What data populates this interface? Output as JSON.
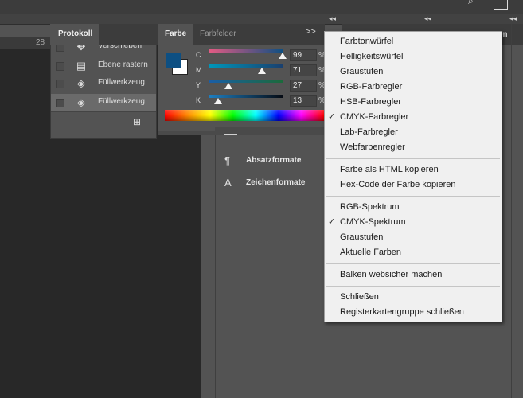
{
  "ruler": {
    "number": "28"
  },
  "dock": {
    "collapse_arrow": "◂◂"
  },
  "history_panel": {
    "tab_label": "Protokoll",
    "rows": [
      {
        "label": "Verschieben",
        "icon": "move-icon",
        "selected": false
      },
      {
        "label": "Ebene rastern",
        "icon": "document-icon",
        "selected": false
      },
      {
        "label": "Füllwerkzeug",
        "icon": "paint-bucket-icon",
        "selected": false
      },
      {
        "label": "Füllwerkzeug",
        "icon": "paint-bucket-icon",
        "selected": true
      }
    ],
    "new_snapshot_icon": "camera-icon"
  },
  "color_panel": {
    "tabs": [
      {
        "label": "Farbe"
      },
      {
        "label": "Farbfelder"
      }
    ],
    "foreground_color": "#0d4f82",
    "background_color": "#ffffff",
    "sliders": [
      {
        "label": "C",
        "value": "99",
        "unit": "%",
        "fraction": 0.99
      },
      {
        "label": "M",
        "value": "71",
        "unit": "%",
        "fraction": 0.71
      },
      {
        "label": "Y",
        "value": "27",
        "unit": "%",
        "fraction": 0.27
      },
      {
        "label": "K",
        "value": "13",
        "unit": "%",
        "fraction": 0.13
      }
    ],
    "expand_label": ">>"
  },
  "paragraph_panel": {
    "items": [
      {
        "label": "Absatzformate",
        "icon": "paragraph-styles-icon"
      },
      {
        "label": "Zeichenformate",
        "icon": "character-styles-icon"
      }
    ]
  },
  "context_menu": {
    "groups": [
      [
        {
          "label": "Farbtonwürfel",
          "checked": false
        },
        {
          "label": "Helligkeitswürfel",
          "checked": false
        },
        {
          "label": "Graustufen",
          "checked": false
        },
        {
          "label": "RGB-Farbregler",
          "checked": false
        },
        {
          "label": "HSB-Farbregler",
          "checked": false
        },
        {
          "label": "CMYK-Farbregler",
          "checked": true
        },
        {
          "label": "Lab-Farbregler",
          "checked": false
        },
        {
          "label": "Webfarbenregler",
          "checked": false
        }
      ],
      [
        {
          "label": "Farbe als HTML kopieren",
          "checked": false
        },
        {
          "label": "Hex-Code der Farbe kopieren",
          "checked": false
        }
      ],
      [
        {
          "label": "RGB-Spektrum",
          "checked": false
        },
        {
          "label": "CMYK-Spektrum",
          "checked": true
        },
        {
          "label": "Graustufen",
          "checked": false
        },
        {
          "label": "Aktuelle Farben",
          "checked": false
        }
      ],
      [
        {
          "label": "Balken websicher machen",
          "checked": false
        }
      ],
      [
        {
          "label": "Schließen",
          "checked": false
        },
        {
          "label": "Registerkartengruppe schließen",
          "checked": false
        }
      ]
    ],
    "check_mark": "✓"
  },
  "right_dock": {
    "tab_partial": "en"
  },
  "colors": {
    "app_bg": "#535353",
    "canvas_bg": "#282828",
    "menu_bg": "#f0f0f0",
    "menu_text": "#1a1a1a"
  }
}
